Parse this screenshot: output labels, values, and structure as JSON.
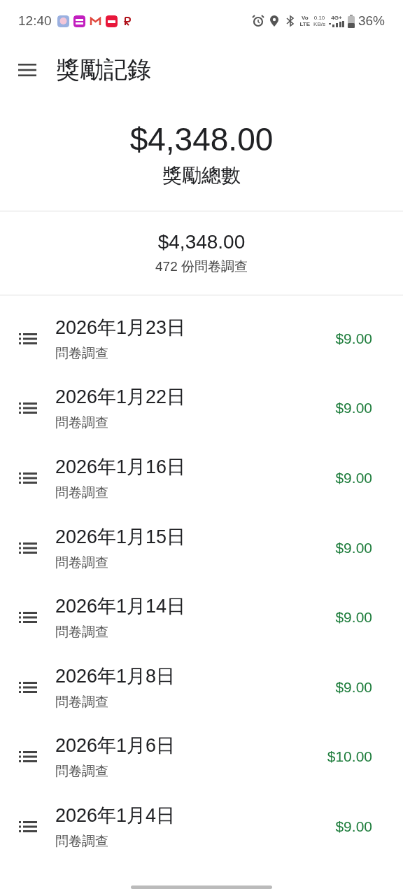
{
  "status_bar": {
    "time": "12:40",
    "volte_top": "Vo",
    "volte_bottom": "LTE",
    "speed_value": "0.10",
    "speed_unit": "KB/s",
    "network": "4G+",
    "battery": "36%"
  },
  "app_bar": {
    "title": "獎勵記錄"
  },
  "total": {
    "amount": "$4,348.00",
    "label": "獎勵總數"
  },
  "summary": {
    "amount": "$4,348.00",
    "count": "472 份問卷調查"
  },
  "rewards": [
    {
      "date": "2026年1月23日",
      "type": "問卷調查",
      "amount": "$9.00"
    },
    {
      "date": "2026年1月22日",
      "type": "問卷調查",
      "amount": "$9.00"
    },
    {
      "date": "2026年1月16日",
      "type": "問卷調查",
      "amount": "$9.00"
    },
    {
      "date": "2026年1月15日",
      "type": "問卷調查",
      "amount": "$9.00"
    },
    {
      "date": "2026年1月14日",
      "type": "問卷調查",
      "amount": "$9.00"
    },
    {
      "date": "2026年1月8日",
      "type": "問卷調查",
      "amount": "$9.00"
    },
    {
      "date": "2026年1月6日",
      "type": "問卷調查",
      "amount": "$10.00"
    },
    {
      "date": "2026年1月4日",
      "type": "問卷調查",
      "amount": "$9.00"
    }
  ]
}
